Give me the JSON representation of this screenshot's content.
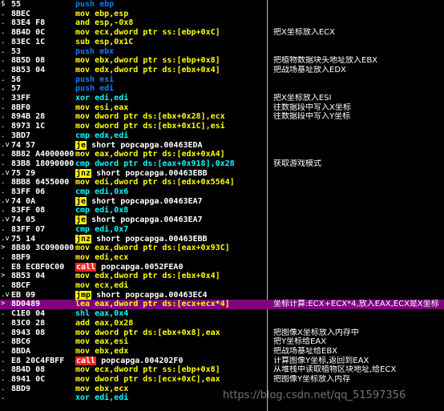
{
  "rows": [
    {
      "mark": "$",
      "hex": "55",
      "op": "push",
      "opStyle": "c-blue",
      "args": "ebp",
      "argStyle": "c-blue",
      "cmt": ""
    },
    {
      "mark": ".",
      "hex": "8BEC",
      "op": "mov",
      "opStyle": "c-yellow",
      "args": "ebp,esp",
      "argStyle": "c-yellow",
      "cmt": ""
    },
    {
      "mark": ".",
      "hex": "83E4 F8",
      "op": "and",
      "opStyle": "c-yellow",
      "args": "esp,-0x8",
      "argStyle": "c-yellow",
      "cmt": ""
    },
    {
      "mark": ".",
      "hex": "8B4D 0C",
      "op": "mov",
      "opStyle": "c-yellow",
      "args": "ecx,dword ptr ss:[ebp+0xC]",
      "argStyle": "c-yellow",
      "cmt": "把X坐标放入ECX"
    },
    {
      "mark": ".",
      "hex": "83EC 1C",
      "op": "sub",
      "opStyle": "c-yellow",
      "args": "esp,0x1C",
      "argStyle": "c-yellow",
      "cmt": ""
    },
    {
      "mark": ".",
      "hex": "53",
      "op": "push",
      "opStyle": "c-blue",
      "args": "ebx",
      "argStyle": "c-blue",
      "cmt": ""
    },
    {
      "mark": ".",
      "hex": "8B5D 08",
      "op": "mov",
      "opStyle": "c-yellow",
      "args": "ebx,dword ptr ss:[ebp+0x8]",
      "argStyle": "c-yellow",
      "cmt": "把植物数据块头地址放入EBX"
    },
    {
      "mark": ".",
      "hex": "8B53 04",
      "op": "mov",
      "opStyle": "c-yellow",
      "args": "edx,dword ptr ds:[ebx+0x4]",
      "argStyle": "c-yellow",
      "cmt": "把战场基址放入EDX"
    },
    {
      "mark": ".",
      "hex": "56",
      "op": "push",
      "opStyle": "c-blue",
      "args": "esi",
      "argStyle": "c-blue",
      "cmt": ""
    },
    {
      "mark": ".",
      "hex": "57",
      "op": "push",
      "opStyle": "c-blue",
      "args": "edi",
      "argStyle": "c-blue",
      "cmt": ""
    },
    {
      "mark": ".",
      "hex": "33FF",
      "op": "xor",
      "opStyle": "c-cyan",
      "args": "edi,edi",
      "argStyle": "c-cyan",
      "cmt": "把X坐标放入ESI"
    },
    {
      "mark": ".",
      "hex": "8BF0",
      "op": "mov",
      "opStyle": "c-yellow",
      "args": "esi,eax",
      "argStyle": "c-yellow",
      "cmt": "往数据段中写入X坐标"
    },
    {
      "mark": ".",
      "hex": "894B 28",
      "op": "mov",
      "opStyle": "c-yellow",
      "args": "dword ptr ds:[ebx+0x28],ecx",
      "argStyle": "c-yellow",
      "cmt": "往数据段中写入Y坐标"
    },
    {
      "mark": ".",
      "hex": "8973 1C",
      "op": "mov",
      "opStyle": "c-yellow",
      "args": "dword ptr ds:[ebx+0x1C],esi",
      "argStyle": "c-yellow",
      "cmt": ""
    },
    {
      "mark": ".",
      "hex": "3BD7",
      "op": "cmp",
      "opStyle": "c-cyan",
      "args": "edx,edi",
      "argStyle": "c-cyan",
      "cmt": ""
    },
    {
      "mark": ".v",
      "hex": "74 57",
      "op": "je",
      "opStyle": "c-bg-yellow",
      "args": "short popcapga.00463EDA",
      "argStyle": "c-white",
      "cmt": ""
    },
    {
      "mark": ".",
      "hex": "8B82 A4000000",
      "op": "mov",
      "opStyle": "c-yellow",
      "args": "eax,dword ptr ds:[edx+0xA4]",
      "argStyle": "c-yellow",
      "cmt": ""
    },
    {
      "mark": ".",
      "hex": "83B8 18090000",
      "op": "cmp",
      "opStyle": "c-cyan",
      "args": "dword ptr ds:[eax+0x918],0x28",
      "argStyle": "c-cyan",
      "cmt": "获取游戏模式"
    },
    {
      "mark": ".v",
      "hex": "75 29",
      "op": "jnz",
      "opStyle": "c-bg-yellow",
      "args": "short popcapga.00463EBB",
      "argStyle": "c-white",
      "cmt": ""
    },
    {
      "mark": ".",
      "hex": "8BB8 6455000",
      "op": "mov",
      "opStyle": "c-yellow",
      "args": "edi,dword ptr ds:[edx+0x5564]",
      "argStyle": "c-yellow",
      "cmt": ""
    },
    {
      "mark": ".",
      "hex": "83FF 06",
      "op": "cmp",
      "opStyle": "c-cyan",
      "args": "edi,0x6",
      "argStyle": "c-cyan",
      "cmt": ""
    },
    {
      "mark": ".v",
      "hex": "74 0A",
      "op": "je",
      "opStyle": "c-bg-yellow",
      "args": "short popcapga.00463EA7",
      "argStyle": "c-white",
      "cmt": ""
    },
    {
      "mark": ".",
      "hex": "83FF 08",
      "op": "cmp",
      "opStyle": "c-cyan",
      "args": "edi,0x8",
      "argStyle": "c-cyan",
      "cmt": ""
    },
    {
      "mark": ".v",
      "hex": "74 05",
      "op": "je",
      "opStyle": "c-bg-yellow",
      "args": "short popcapga.00463EA7",
      "argStyle": "c-white",
      "cmt": ""
    },
    {
      "mark": ".",
      "hex": "83FF 07",
      "op": "cmp",
      "opStyle": "c-cyan",
      "args": "edi,0x7",
      "argStyle": "c-cyan",
      "cmt": ""
    },
    {
      "mark": ".v",
      "hex": "75 14",
      "op": "jnz",
      "opStyle": "c-bg-yellow",
      "args": "short popcapga.00463EBB",
      "argStyle": "c-white",
      "cmt": ""
    },
    {
      "mark": ">",
      "hex": "8B80 3C090000",
      "op": "mov",
      "opStyle": "c-yellow",
      "args": "eax,dword ptr ds:[eax+0x93C]",
      "argStyle": "c-yellow",
      "cmt": ""
    },
    {
      "mark": ".",
      "hex": "8BF9",
      "op": "mov",
      "opStyle": "c-yellow",
      "args": "edi,ecx",
      "argStyle": "c-yellow",
      "cmt": ""
    },
    {
      "mark": ".",
      "hex": "E8 ECBF0C00",
      "op": "call",
      "opStyle": "c-bg-red",
      "args": "popcapga.0052FEA0",
      "argStyle": "c-white",
      "cmt": ""
    },
    {
      "mark": ">",
      "hex": "8B53 04",
      "op": "mov",
      "opStyle": "c-yellow",
      "args": "edx,dword ptr ds:[ebx+0x4]",
      "argStyle": "c-yellow",
      "cmt": ""
    },
    {
      "mark": ".",
      "hex": "8BCF",
      "op": "mov",
      "opStyle": "c-yellow",
      "args": "ecx,edi",
      "argStyle": "c-yellow",
      "cmt": ""
    },
    {
      "mark": ".v",
      "hex": "EB 09",
      "op": "jmp",
      "opStyle": "c-bg-yellow",
      "args": "short popcapga.00463EC4",
      "argStyle": "c-white",
      "cmt": ""
    },
    {
      "mark": ">",
      "hex": "8D0489",
      "op": "lea",
      "opStyle": "c-yellow",
      "args": "eax,dword ptr ds:[ecx+ecx*4]",
      "argStyle": "c-yellow",
      "cmt": "坐标计算:ECX+ECX*4,放入EAX,ECX是X坐标",
      "hl": true
    },
    {
      "mark": ".",
      "hex": "C1E0 04",
      "op": "shl",
      "opStyle": "c-cyan",
      "args": "eax,0x4",
      "argStyle": "c-cyan",
      "cmt": ""
    },
    {
      "mark": ".",
      "hex": "83C0 28",
      "op": "add",
      "opStyle": "c-yellow",
      "args": "eax,0x28",
      "argStyle": "c-yellow",
      "cmt": ""
    },
    {
      "mark": ".",
      "hex": "8943 08",
      "op": "mov",
      "opStyle": "c-yellow",
      "args": "dword ptr ds:[ebx+0x8],eax",
      "argStyle": "c-yellow",
      "cmt": "把图像X坐标放入内存中"
    },
    {
      "mark": ".",
      "hex": "8BC6",
      "op": "mov",
      "opStyle": "c-yellow",
      "args": "eax,esi",
      "argStyle": "c-yellow",
      "cmt": "把Y坐标给EAX"
    },
    {
      "mark": ".",
      "hex": "8BDA",
      "op": "mov",
      "opStyle": "c-yellow",
      "args": "ebx,edx",
      "argStyle": "c-yellow",
      "cmt": "把战场基址给EBX"
    },
    {
      "mark": ".",
      "hex": "E8 20C4FBFF",
      "op": "call",
      "opStyle": "c-bg-red",
      "args": "popcapga.004202F0",
      "argStyle": "c-white",
      "cmt": "计算图像Y坐标,返回到EAX"
    },
    {
      "mark": ".",
      "hex": "8B4D 08",
      "op": "mov",
      "opStyle": "c-yellow",
      "args": "ecx,dword ptr ss:[ebp+0x8]",
      "argStyle": "c-yellow",
      "cmt": "从堆栈中读取植物区块地址,给ECX"
    },
    {
      "mark": ".",
      "hex": "8941 0C",
      "op": "mov",
      "opStyle": "c-yellow",
      "args": "dword ptr ds:[ecx+0xC],eax",
      "argStyle": "c-yellow",
      "cmt": "把图像Y坐标放入内存"
    },
    {
      "mark": ".",
      "hex": "8BD9",
      "op": "mov",
      "opStyle": "c-yellow",
      "args": "ebx,ecx",
      "argStyle": "c-yellow",
      "cmt": ""
    },
    {
      "mark": ".",
      "hex": "",
      "op": "xor",
      "opStyle": "c-cyan",
      "args": "edi,edi",
      "argStyle": "c-cyan",
      "cmt": ""
    }
  ],
  "watermark": "https://blog.csdn.net/qq_51597356"
}
